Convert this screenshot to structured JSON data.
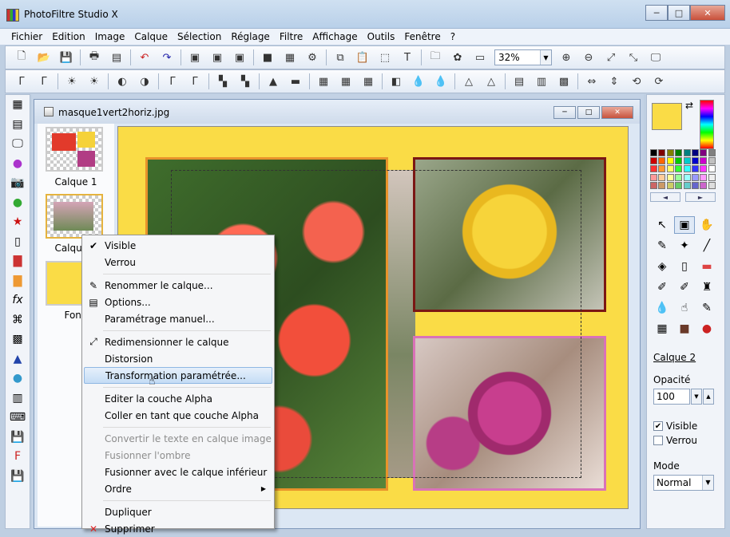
{
  "app": {
    "title": "PhotoFiltre Studio X"
  },
  "menu": [
    "Fichier",
    "Edition",
    "Image",
    "Calque",
    "Sélection",
    "Réglage",
    "Filtre",
    "Affichage",
    "Outils",
    "Fenêtre",
    "?"
  ],
  "toolbar": {
    "zoom": "32%"
  },
  "document": {
    "title": "masque1vert2horiz.jpg"
  },
  "layers": [
    {
      "label": "Calque 1"
    },
    {
      "label": "Calque 2"
    },
    {
      "label": "Fond"
    }
  ],
  "context_menu": [
    {
      "label": "Visible",
      "icon": "check-icon",
      "enabled": true
    },
    {
      "label": "Verrou",
      "icon": "",
      "enabled": true
    },
    {
      "label": "Renommer le calque...",
      "icon": "rename-icon",
      "enabled": true
    },
    {
      "label": "Options...",
      "icon": "options-icon",
      "enabled": true
    },
    {
      "label": "Paramétrage manuel...",
      "icon": "",
      "enabled": true
    },
    {
      "label": "Redimensionner le calque",
      "icon": "resize-icon",
      "enabled": true
    },
    {
      "label": "Distorsion",
      "icon": "",
      "enabled": true
    },
    {
      "label": "Transformation paramétrée...",
      "icon": "",
      "enabled": true,
      "highlighted": true
    },
    {
      "label": "Editer la couche Alpha",
      "icon": "",
      "enabled": true
    },
    {
      "label": "Coller en tant que couche Alpha",
      "icon": "",
      "enabled": true
    },
    {
      "label": "Convertir le texte en calque image",
      "icon": "",
      "enabled": false
    },
    {
      "label": "Fusionner l'ombre",
      "icon": "",
      "enabled": false
    },
    {
      "label": "Fusionner avec le calque inférieur",
      "icon": "",
      "enabled": true
    },
    {
      "label": "Ordre",
      "icon": "",
      "enabled": true,
      "submenu": true
    },
    {
      "label": "Dupliquer",
      "icon": "",
      "enabled": true
    },
    {
      "label": "Supprimer",
      "icon": "delete-icon",
      "enabled": true
    }
  ],
  "right_panel": {
    "layer_name": "Calque 2",
    "opacity_label": "Opacité",
    "opacity_value": "100",
    "visible_label": "Visible",
    "visible_checked": true,
    "lock_label": "Verrou",
    "lock_checked": false,
    "mode_label": "Mode",
    "mode_value": "Normal"
  },
  "colors": {
    "foreground": "#fadc46",
    "background": "#ffffff",
    "canvas": "#fadc46"
  }
}
